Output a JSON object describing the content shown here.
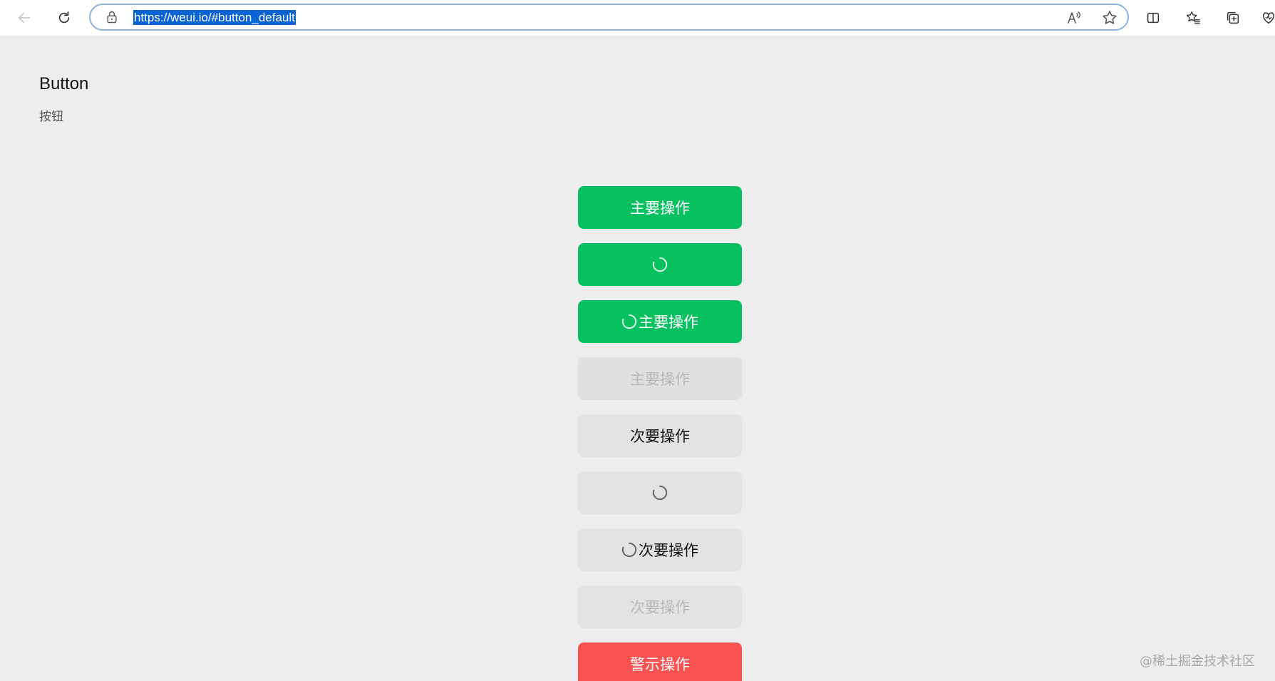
{
  "browser": {
    "url": "https://weui.io/#button_default"
  },
  "page": {
    "title": "Button",
    "subtitle": "按钮"
  },
  "buttons": {
    "primary": "主要操作",
    "primary_loading_label": "主要操作",
    "primary_disabled": "主要操作",
    "secondary": "次要操作",
    "secondary_loading_label": "次要操作",
    "secondary_disabled": "次要操作",
    "warn": "警示操作"
  },
  "colors": {
    "primary": "#07c160",
    "warn": "#fa5151",
    "background": "#ededed"
  },
  "watermark": "@稀土掘金技术社区"
}
